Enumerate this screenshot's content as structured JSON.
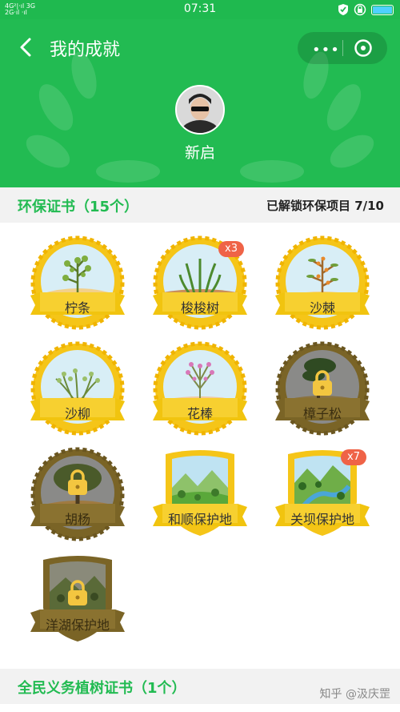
{
  "status_bar": {
    "time": "07:31",
    "network_top": "4G²|·ıl 3G",
    "network_bottom": "2G·ıl ·ıl"
  },
  "header": {
    "title": "我的成就",
    "more_label": "•••",
    "user_name": "新启"
  },
  "eco_section": {
    "title": "环保证书（15个）",
    "progress": "已解锁环保项目 7/10"
  },
  "badges": [
    {
      "label": "柠条",
      "locked": false,
      "count": ""
    },
    {
      "label": "梭梭树",
      "locked": false,
      "count": "x3"
    },
    {
      "label": "沙棘",
      "locked": false,
      "count": ""
    },
    {
      "label": "沙柳",
      "locked": false,
      "count": ""
    },
    {
      "label": "花棒",
      "locked": false,
      "count": ""
    },
    {
      "label": "樟子松",
      "locked": true,
      "count": ""
    },
    {
      "label": "胡杨",
      "locked": true,
      "count": ""
    },
    {
      "label": "和顺保护地",
      "locked": false,
      "count": ""
    },
    {
      "label": "关坝保护地",
      "locked": false,
      "count": "x7"
    },
    {
      "label": "洋湖保护地",
      "locked": true,
      "count": ""
    }
  ],
  "tree_section": {
    "title": "全民义务植树证书（1个）"
  },
  "watermark": "知乎 @汲庆罡",
  "colors": {
    "brand_green": "#22bb52",
    "badge_gold": "#f5c518",
    "ribbon_gold": "#f1c40f",
    "locked_brown": "#8a7230",
    "count_red": "#ef6347"
  }
}
